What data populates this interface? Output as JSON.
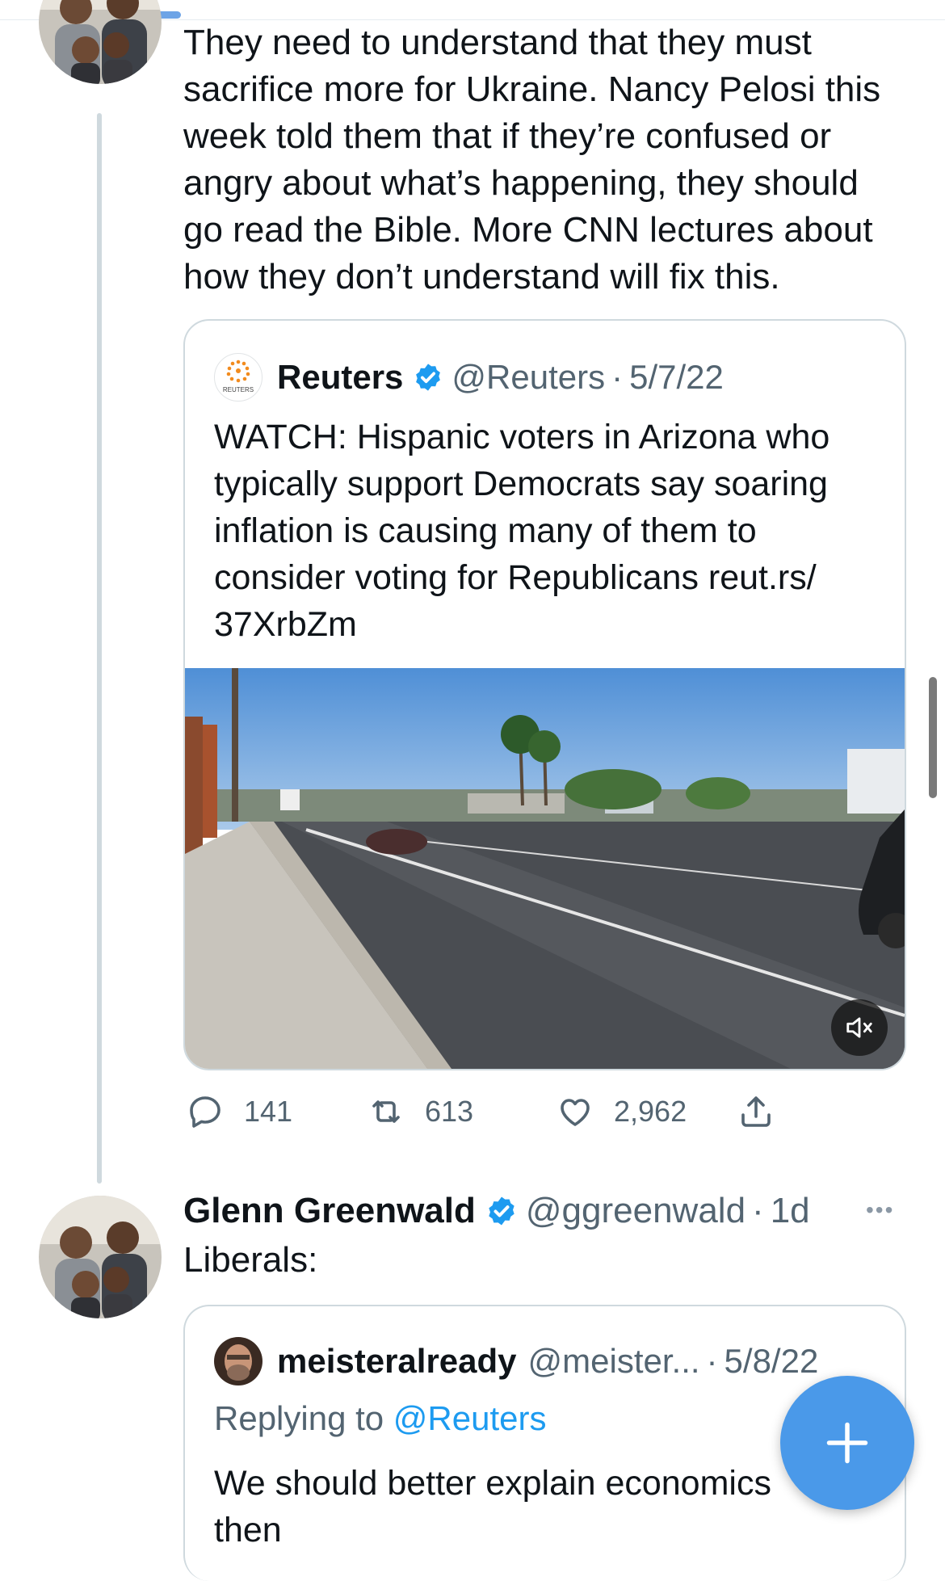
{
  "tweet1": {
    "text": "They need to understand that they must\nsacrifice more for Ukraine. Nancy Pelosi this\nweek told them that if they’re confused or\nangry about what’s happening, they should\ngo read the Bible. More CNN lectures about\nhow they don’t understand will fix this.",
    "quote": {
      "avatar_label": "REUTERS",
      "name": "Reuters",
      "handle": "@Reuters",
      "separator": "·",
      "date": "5/7/22",
      "text": "WATCH: Hispanic voters in Arizona who\ntypically support Democrats say soaring\ninflation is causing many of them to\nconsider voting for Republicans reut.rs/\n37XrbZm"
    },
    "actions": {
      "replies": "141",
      "retweets": "613",
      "likes": "2,962"
    }
  },
  "tweet2": {
    "name": "Glenn Greenwald",
    "handle": "@ggreenwald",
    "separator": "·",
    "time": "1d",
    "more": "•••",
    "text": "Liberals:",
    "quote": {
      "name": "meisteralready",
      "handle": "@meister...",
      "separator": "·",
      "date": "5/8/22",
      "replying_prefix": "Replying to ",
      "replying_handle": "@Reuters",
      "text": "We should better explain economics\nthen"
    }
  },
  "colors": {
    "accent": "#1d9bf0",
    "fab": "#4a99e9",
    "muted": "#536471",
    "border": "#cfd9de"
  },
  "icons": [
    "reply-icon",
    "retweet-icon",
    "like-icon",
    "share-icon",
    "mute-icon",
    "verified-badge-icon",
    "compose-plus-icon",
    "more-icon"
  ]
}
